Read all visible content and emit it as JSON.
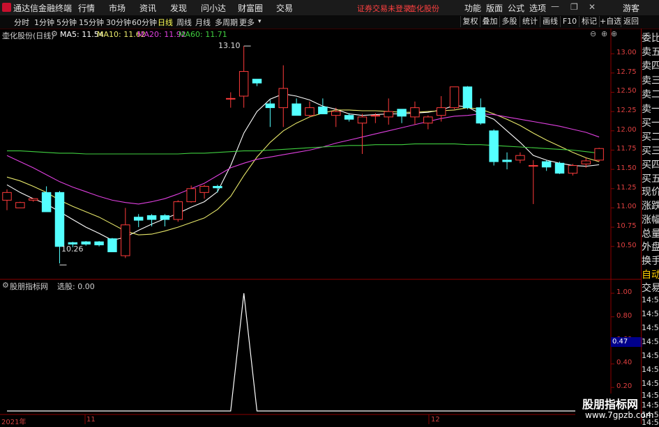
{
  "app": {
    "title": "通达信金融终端"
  },
  "menu": [
    "行情",
    "市场",
    "资讯",
    "发现",
    "问小达",
    "财富圈",
    "交易"
  ],
  "menu_status": "证券交易未登录",
  "menu_stock": "壶化股份",
  "menu_right": [
    "功能",
    "版面",
    "公式",
    "选项"
  ],
  "guest": "游客",
  "periods": [
    "分时",
    "1分钟",
    "5分钟",
    "15分钟",
    "30分钟",
    "60分钟",
    "日线",
    "周线",
    "月线",
    "多周期",
    "更多"
  ],
  "right_tools": [
    "复权",
    "叠加",
    "多股",
    "统计",
    "画线",
    "F10",
    "标记",
    "+自选",
    "返回"
  ],
  "main_chart": {
    "name": "壶化股份(日线)",
    "ma": [
      {
        "label": "MA5: 11.54",
        "color": "#ffffff"
      },
      {
        "label": "MA10: 11.62",
        "color": "#e8e86a"
      },
      {
        "label": "MA20: 11.92",
        "color": "#e040e0"
      },
      {
        "label": "MA60: 11.71",
        "color": "#40d040"
      }
    ],
    "high_label": "13.10",
    "low_label": "10.26",
    "yticks": [
      "13.00",
      "12.75",
      "12.50",
      "12.25",
      "12.00",
      "11.75",
      "11.50",
      "11.25",
      "11.00",
      "10.75",
      "10.50"
    ]
  },
  "sub_chart": {
    "name": "股朋指标网",
    "value_label": "选股: 0.00",
    "yticks": [
      "1.00",
      "0.80",
      "0.60",
      "0.40",
      "0.20"
    ],
    "cursor_value": "0.47"
  },
  "date_labels": [
    "2021年",
    "11",
    "12"
  ],
  "side_quote": [
    "委比",
    "卖五",
    "卖四",
    "卖三",
    "卖二",
    "卖一",
    "买一",
    "买二",
    "买三",
    "买四",
    "买五",
    "现价",
    "涨跌",
    "涨幅",
    "总量",
    "外盘",
    "换手",
    "净资",
    "收益"
  ],
  "side_lower": [
    "自动",
    "交易",
    "14:55",
    "14:56",
    "14:56",
    "14:56",
    "14:56",
    "14:56",
    "14:56",
    "14:56",
    "14:56",
    "14:56",
    "14:56"
  ],
  "watermark": {
    "line1": "股朋指标网",
    "line2": "www.7gpzb.com"
  },
  "colors": {
    "up": "#ff3b3b",
    "down": "#54ffff",
    "grid": "#8b0000",
    "axis_text": "#e04040"
  },
  "chart_data": {
    "type": "candlestick",
    "ylim": [
      10.2,
      13.2
    ],
    "candles": [
      [
        11.1,
        11.2,
        10.97,
        11.24
      ],
      [
        11.0,
        11.07,
        11.03,
        11.08
      ],
      [
        11.1,
        11.12,
        11.08,
        11.12
      ],
      [
        11.2,
        10.95,
        11.28,
        11.1
      ],
      [
        11.2,
        10.5,
        10.28,
        11.22
      ],
      [
        10.55,
        10.53,
        10.49,
        10.56
      ],
      [
        10.56,
        10.53,
        10.51,
        10.57
      ],
      [
        10.56,
        10.52,
        10.5,
        10.57
      ],
      [
        10.6,
        10.43,
        10.43,
        10.61
      ],
      [
        10.38,
        10.78,
        10.35,
        11.0
      ],
      [
        10.88,
        10.84,
        10.75,
        10.92
      ],
      [
        10.9,
        10.85,
        10.76,
        10.92
      ],
      [
        10.9,
        10.85,
        10.76,
        10.92
      ],
      [
        10.85,
        11.08,
        10.82,
        11.1
      ],
      [
        11.08,
        11.25,
        11.07,
        11.29
      ],
      [
        11.2,
        11.28,
        11.12,
        11.3
      ],
      [
        11.28,
        11.26,
        11.2,
        11.3
      ],
      [
        12.42,
        12.42,
        12.3,
        12.5
      ],
      [
        12.45,
        12.77,
        12.3,
        13.1
      ],
      [
        12.67,
        12.62,
        12.58,
        12.65
      ],
      [
        12.35,
        12.3,
        12.05,
        12.4
      ],
      [
        12.3,
        12.55,
        12.05,
        12.85
      ],
      [
        12.35,
        12.2,
        12.2,
        12.42
      ],
      [
        12.2,
        12.3,
        12.18,
        12.38
      ],
      [
        12.31,
        12.22,
        12.24,
        12.42
      ],
      [
        12.2,
        12.25,
        12.05,
        12.3
      ],
      [
        12.2,
        12.15,
        12.12,
        12.23
      ],
      [
        12.1,
        12.18,
        11.7,
        12.22
      ],
      [
        12.2,
        12.2,
        12.1,
        12.23
      ],
      [
        12.18,
        12.25,
        12.08,
        12.42
      ],
      [
        12.28,
        12.19,
        12.1,
        12.28
      ],
      [
        12.18,
        12.3,
        12.08,
        12.38
      ],
      [
        12.1,
        12.18,
        12.02,
        12.2
      ],
      [
        12.2,
        12.3,
        12.12,
        12.45
      ],
      [
        12.3,
        12.57,
        12.28,
        12.57
      ],
      [
        12.57,
        12.3,
        12.28,
        12.58
      ],
      [
        12.3,
        12.1,
        12.08,
        12.42
      ],
      [
        12.0,
        11.6,
        11.55,
        12.02
      ],
      [
        11.62,
        11.6,
        11.5,
        11.72
      ],
      [
        11.62,
        11.68,
        11.58,
        11.72
      ],
      [
        11.55,
        11.55,
        11.05,
        11.62
      ],
      [
        11.6,
        11.53,
        11.48,
        11.62
      ],
      [
        11.58,
        11.45,
        11.44,
        11.6
      ],
      [
        11.45,
        11.55,
        11.42,
        11.57
      ],
      [
        11.57,
        11.61,
        11.52,
        11.65
      ],
      [
        11.62,
        11.77,
        11.6,
        11.78
      ]
    ],
    "ma5": [
      11.3,
      11.2,
      11.12,
      11.05,
      10.95,
      10.85,
      10.75,
      10.67,
      10.58,
      10.62,
      10.71,
      10.79,
      10.86,
      10.93,
      11.01,
      11.08,
      11.21,
      11.55,
      11.97,
      12.25,
      12.41,
      12.48,
      12.45,
      12.4,
      12.32,
      12.28,
      12.22,
      12.2,
      12.21,
      12.22,
      12.22,
      12.23,
      12.24,
      12.27,
      12.33,
      12.31,
      12.22,
      12.15,
      12.0,
      11.85,
      11.68,
      11.62,
      11.58,
      11.55,
      11.54,
      11.56
    ],
    "ma10": [
      11.4,
      11.35,
      11.28,
      11.2,
      11.1,
      11.02,
      10.95,
      10.88,
      10.79,
      10.7,
      10.65,
      10.66,
      10.7,
      10.75,
      10.81,
      10.87,
      10.98,
      11.15,
      11.42,
      11.66,
      11.85,
      12.0,
      12.1,
      12.18,
      12.23,
      12.27,
      12.27,
      12.26,
      12.26,
      12.25,
      12.24,
      12.24,
      12.25,
      12.26,
      12.27,
      12.3,
      12.28,
      12.22,
      12.15,
      12.07,
      11.97,
      11.88,
      11.8,
      11.72,
      11.65,
      11.6
    ],
    "ma20": [
      11.68,
      11.6,
      11.52,
      11.43,
      11.34,
      11.27,
      11.21,
      11.15,
      11.1,
      11.07,
      11.05,
      11.08,
      11.12,
      11.18,
      11.25,
      11.32,
      11.42,
      11.52,
      11.58,
      11.63,
      11.66,
      11.69,
      11.72,
      11.75,
      11.79,
      11.84,
      11.88,
      11.92,
      11.96,
      12.0,
      12.04,
      12.08,
      12.12,
      12.16,
      12.19,
      12.2,
      12.22,
      12.21,
      12.18,
      12.15,
      12.12,
      12.09,
      12.06,
      12.02,
      11.98,
      11.92
    ],
    "ma60": [
      11.74,
      11.74,
      11.73,
      11.72,
      11.71,
      11.71,
      11.7,
      11.7,
      11.7,
      11.7,
      11.7,
      11.7,
      11.7,
      11.7,
      11.71,
      11.71,
      11.72,
      11.73,
      11.74,
      11.74,
      11.75,
      11.76,
      11.77,
      11.78,
      11.79,
      11.8,
      11.81,
      11.81,
      11.82,
      11.82,
      11.82,
      11.83,
      11.83,
      11.83,
      11.83,
      11.82,
      11.82,
      11.81,
      11.8,
      11.79,
      11.78,
      11.77,
      11.76,
      11.75,
      11.73,
      11.71
    ],
    "indicator": {
      "name": "选股",
      "ylim": [
        0,
        1.0
      ],
      "values": [
        0,
        0,
        0,
        0,
        0,
        0,
        0,
        0,
        0,
        0,
        0,
        0,
        0,
        0,
        0,
        0,
        0,
        0,
        1,
        0,
        0,
        0,
        0,
        0,
        0,
        0,
        0,
        0,
        0,
        0,
        0,
        0,
        0,
        0,
        0,
        0,
        0,
        0,
        0,
        0,
        0,
        0,
        0,
        0,
        0,
        0
      ]
    }
  }
}
